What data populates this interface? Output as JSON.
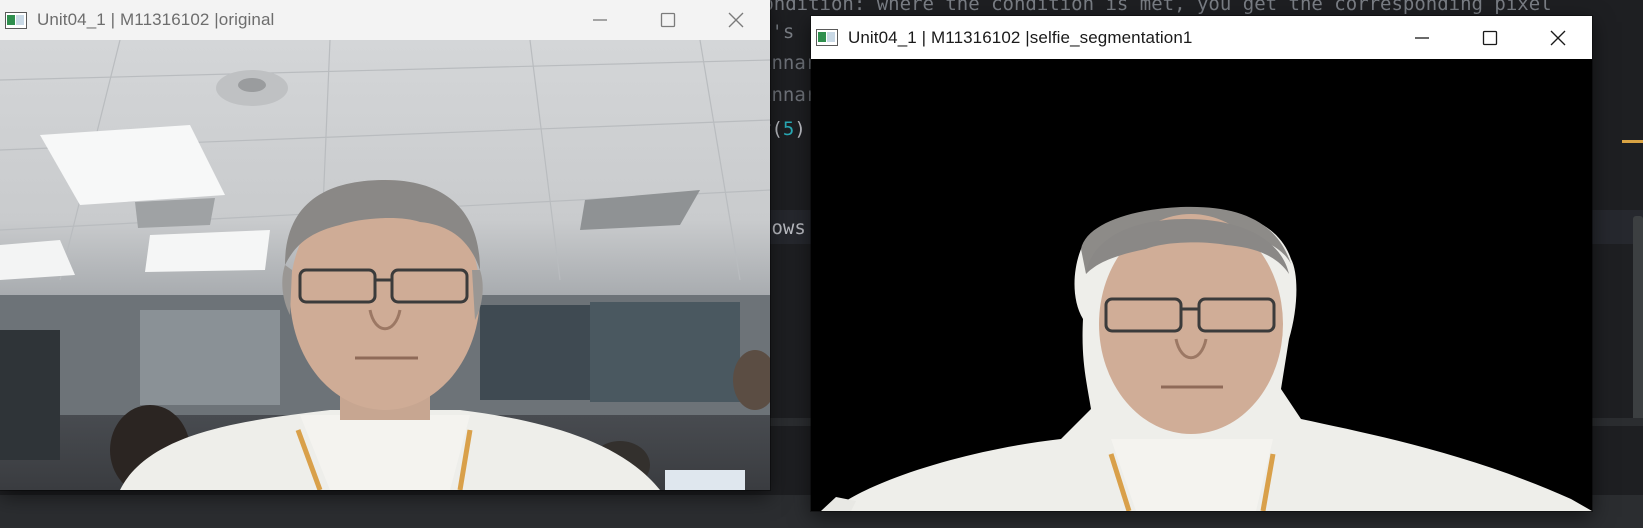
{
  "editor": {
    "lines": [
      {
        "text": "e condition: where the condition is met, you get the corresponding pixel",
        "kind": "comment"
      },
      {
        "text": "t's",
        "kind": "comment"
      },
      {
        "text": "innar",
        "kind": "faded"
      },
      {
        "text": "innar",
        "kind": "faded"
      },
      {
        "prefix": "y(",
        "number": "5",
        "suffix": ")",
        "kind": "code"
      },
      {
        "text": "dows",
        "kind": "code"
      }
    ]
  },
  "windows": {
    "original": {
      "title": "Unit04_1 | M11316102 |original",
      "active": false
    },
    "segmentation": {
      "title": "Unit04_1 | M11316102 |selfie_segmentation1",
      "active": true
    }
  },
  "window_controls": {
    "minimize": "minimize-icon",
    "maximize": "maximize-icon",
    "close": "close-icon"
  },
  "colors": {
    "editor_bg": "#1e1f22",
    "comment": "#7a7e85",
    "number": "#2aacb8",
    "marker": "#d9a343",
    "titlebar": "#ffffff"
  }
}
